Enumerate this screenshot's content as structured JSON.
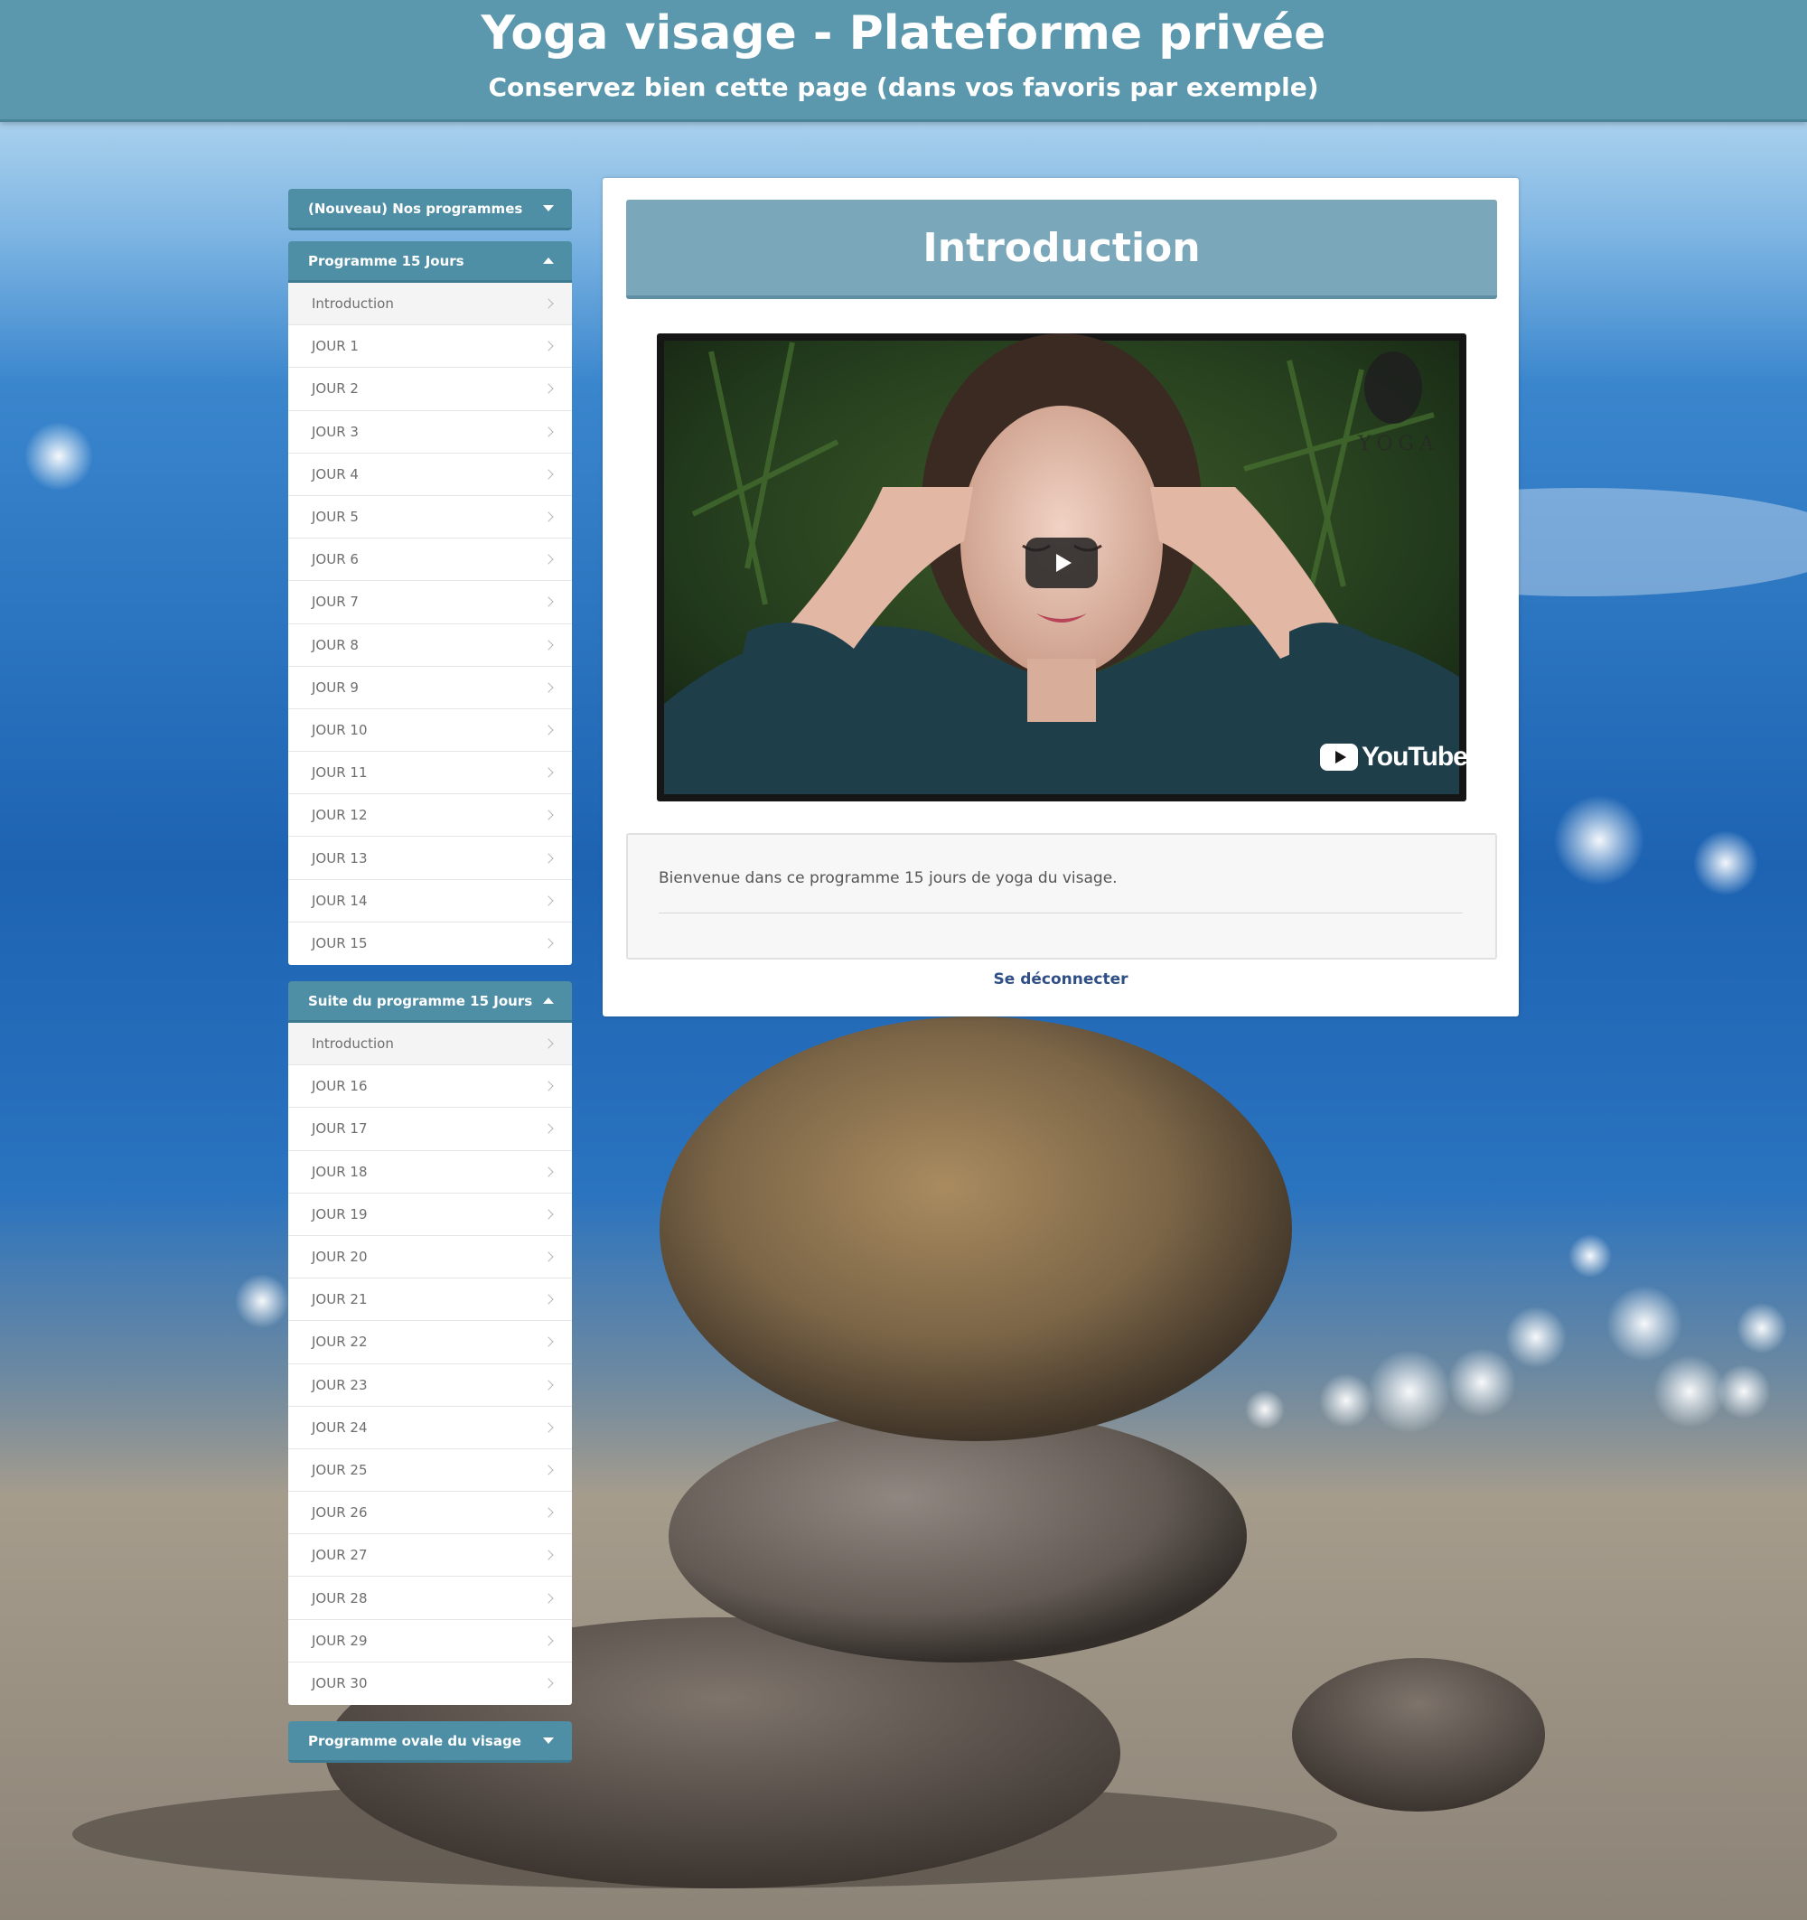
{
  "header": {
    "title": "Yoga visage - Plateforme privée",
    "subtitle": "Conservez bien cette page (dans vos favoris par exemple)"
  },
  "sidebar": {
    "sections": [
      {
        "label": "(Nouveau) Nos programmes",
        "state": "collapsed",
        "items": []
      },
      {
        "label": "Programme 15 Jours",
        "state": "expanded",
        "items": [
          "Introduction",
          "JOUR 1",
          "JOUR 2",
          "JOUR 3",
          "JOUR 4",
          "JOUR 5",
          "JOUR 6",
          "JOUR 7",
          "JOUR 8",
          "JOUR 9",
          "JOUR 10",
          "JOUR 11",
          "JOUR 12",
          "JOUR 13",
          "JOUR 14",
          "JOUR 15"
        ]
      },
      {
        "label": "Suite du programme 15 Jours",
        "state": "expanded",
        "items": [
          "Introduction",
          "JOUR 16",
          "JOUR 17",
          "JOUR 18",
          "JOUR 19",
          "JOUR 20",
          "JOUR 21",
          "JOUR 22",
          "JOUR 23",
          "JOUR 24",
          "JOUR 25",
          "JOUR 26",
          "JOUR 27",
          "JOUR 28",
          "JOUR 29",
          "JOUR 30"
        ]
      },
      {
        "label": "Programme ovale du visage",
        "state": "collapsed",
        "items": []
      }
    ]
  },
  "main": {
    "title": "Introduction",
    "video": {
      "platform_label": "YouTube",
      "watermark": "YOGA",
      "play_icon": "play-icon"
    },
    "description": "Bienvenue dans ce programme 15 jours de yoga du visage.",
    "logout_label": "Se déconnecter"
  },
  "colors": {
    "header_bg": "#5b98ad",
    "section_header_bg": "#4f8fa6",
    "banner_bg": "#7aa8ba",
    "link": "#2f4f86"
  }
}
